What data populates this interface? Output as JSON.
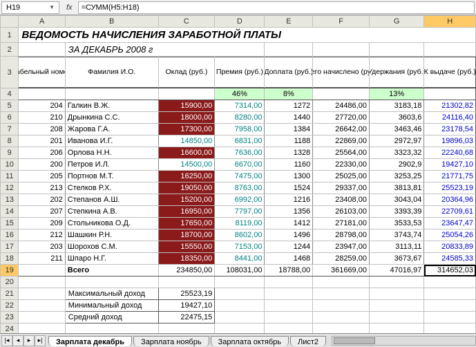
{
  "namebox": "H19",
  "fx_label": "fx",
  "formula": "=СУММ(H5:H18)",
  "col_headers": [
    "A",
    "B",
    "C",
    "D",
    "E",
    "F",
    "G",
    "H"
  ],
  "row_headers": [
    "1",
    "2",
    "3",
    "4",
    "5",
    "6",
    "7",
    "8",
    "9",
    "10",
    "11",
    "12",
    "13",
    "14",
    "15",
    "16",
    "17",
    "18",
    "19",
    "20",
    "21",
    "22",
    "23",
    "24"
  ],
  "title": "ВЕДОМОСТЬ НАЧИСЛЕНИЯ ЗАРАБОТНОЙ ПЛАТЫ",
  "subtitle": "ЗА ДЕКАБРЬ 2008 г",
  "headers": {
    "tab_no": "Табельный номер",
    "name": "Фамилия И.О.",
    "salary": "Оклад (руб.)",
    "bonus": "Премия (руб.)",
    "addpay": "Доплата (руб.)",
    "total": "Всего начислено (руб.)",
    "deduct": "Удержания (руб.)",
    "payout": "К выдаче (руб.)"
  },
  "percents": {
    "bonus": "46%",
    "addpay": "8%",
    "deduct": "13%"
  },
  "rows": [
    {
      "tab": "204",
      "name": "Галкин В.Ж.",
      "salary": "15900,00",
      "salary_dark": true,
      "bonus": "7314,00",
      "addpay": "1272",
      "total": "24486,00",
      "deduct": "3183,18",
      "payout": "21302,82"
    },
    {
      "tab": "210",
      "name": "Дрынкина С.С.",
      "salary": "18000,00",
      "salary_dark": true,
      "bonus": "8280,00",
      "addpay": "1440",
      "total": "27720,00",
      "deduct": "3603,6",
      "payout": "24116,40"
    },
    {
      "tab": "208",
      "name": "Жарова Г.А.",
      "salary": "17300,00",
      "salary_dark": true,
      "bonus": "7958,00",
      "addpay": "1384",
      "total": "26642,00",
      "deduct": "3463,46",
      "payout": "23178,54"
    },
    {
      "tab": "201",
      "name": "Иванова И.Г.",
      "salary": "14850,00",
      "salary_dark": false,
      "bonus": "6831,00",
      "addpay": "1188",
      "total": "22869,00",
      "deduct": "2972,97",
      "payout": "19896,03"
    },
    {
      "tab": "206",
      "name": "Орлова Н.Н.",
      "salary": "16600,00",
      "salary_dark": true,
      "bonus": "7636,00",
      "addpay": "1328",
      "total": "25564,00",
      "deduct": "3323,32",
      "payout": "22240,68"
    },
    {
      "tab": "200",
      "name": "Петров И.Л.",
      "salary": "14500,00",
      "salary_dark": false,
      "bonus": "6670,00",
      "addpay": "1160",
      "total": "22330,00",
      "deduct": "2902,9",
      "payout": "19427,10"
    },
    {
      "tab": "205",
      "name": "Портнов М.Т.",
      "salary": "16250,00",
      "salary_dark": true,
      "bonus": "7475,00",
      "addpay": "1300",
      "total": "25025,00",
      "deduct": "3253,25",
      "payout": "21771,75"
    },
    {
      "tab": "213",
      "name": "Стелков Р.Х.",
      "salary": "19050,00",
      "salary_dark": true,
      "bonus": "8763,00",
      "addpay": "1524",
      "total": "29337,00",
      "deduct": "3813,81",
      "payout": "25523,19"
    },
    {
      "tab": "202",
      "name": "Степанов А.Ш.",
      "salary": "15200,00",
      "salary_dark": true,
      "bonus": "6992,00",
      "addpay": "1216",
      "total": "23408,00",
      "deduct": "3043,04",
      "payout": "20364,96"
    },
    {
      "tab": "207",
      "name": "Степкина А.В.",
      "salary": "16950,00",
      "salary_dark": true,
      "bonus": "7797,00",
      "addpay": "1356",
      "total": "26103,00",
      "deduct": "3393,39",
      "payout": "22709,61"
    },
    {
      "tab": "209",
      "name": "Стольникова О.Д.",
      "salary": "17650,00",
      "salary_dark": true,
      "bonus": "8119,00",
      "addpay": "1412",
      "total": "27181,00",
      "deduct": "3533,53",
      "payout": "23647,47"
    },
    {
      "tab": "212",
      "name": "Шашкин Р.Н.",
      "salary": "18700,00",
      "salary_dark": true,
      "bonus": "8602,00",
      "addpay": "1496",
      "total": "28798,00",
      "deduct": "3743,74",
      "payout": "25054,26"
    },
    {
      "tab": "203",
      "name": "Шорохов С.М.",
      "salary": "15550,00",
      "salary_dark": true,
      "bonus": "7153,00",
      "addpay": "1244",
      "total": "23947,00",
      "deduct": "3113,11",
      "payout": "20833,89"
    },
    {
      "tab": "211",
      "name": "Шпаро Н.Г.",
      "salary": "18350,00",
      "salary_dark": true,
      "bonus": "8441,00",
      "addpay": "1468",
      "total": "28259,00",
      "deduct": "3673,67",
      "payout": "24585,33"
    }
  ],
  "totals": {
    "label": "Всего",
    "salary": "234850,00",
    "bonus": "108031,00",
    "addpay": "18788,00",
    "total": "361669,00",
    "deduct": "47016,97",
    "payout": "314652,03"
  },
  "stats": {
    "max_label": "Максимальный доход",
    "max_val": "25523,19",
    "min_label": "Минимальный доход",
    "min_val": "19427,10",
    "avg_label": "Средний доход",
    "avg_val": "22475,15"
  },
  "tabs": {
    "t1": "Зарплата декабрь",
    "t2": "Зарплата ноябрь",
    "t3": "Зарплата октябрь",
    "t4": "Лист2"
  },
  "active_cell": "H19"
}
